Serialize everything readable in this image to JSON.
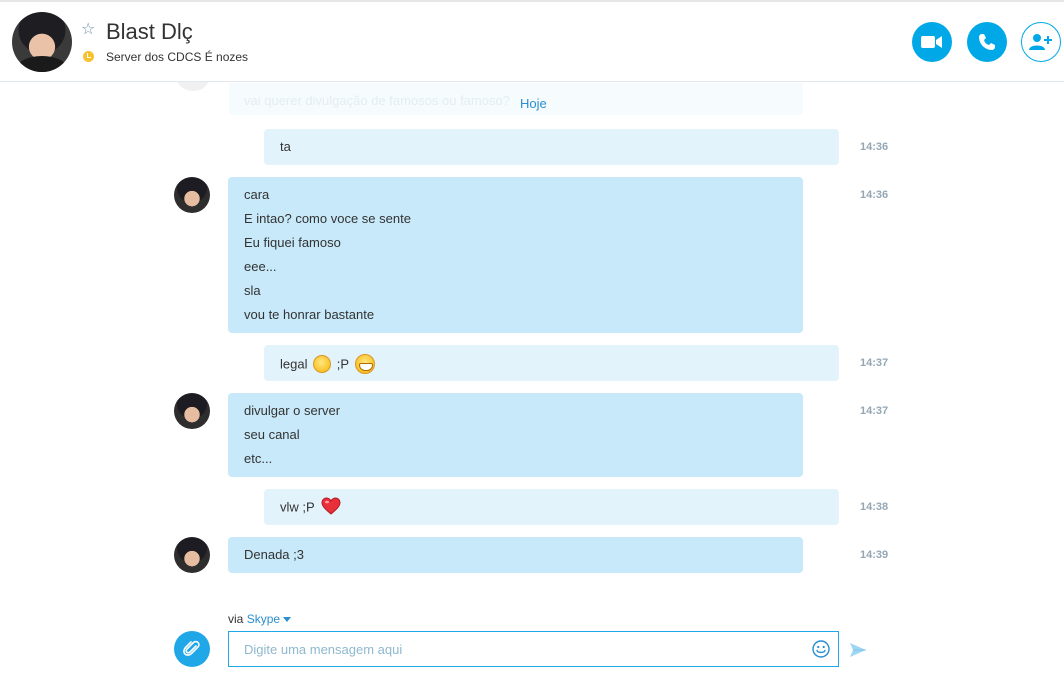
{
  "contact": {
    "name": "Blast Dlç",
    "mood": "Server dos CDCS É nozes",
    "status_color": "#f8c12e"
  },
  "header_buttons": [
    {
      "id": "video-call",
      "icon": "video-camera-icon"
    },
    {
      "id": "audio-call",
      "icon": "phone-icon"
    },
    {
      "id": "add-participant",
      "icon": "add-person-icon"
    }
  ],
  "conversation": {
    "faded_previous": "vai querer divulgação de famosos ou famoso?",
    "day_separator": "Hoje",
    "messages": [
      {
        "direction": "out",
        "lines": [
          "ta"
        ],
        "time": "14:36"
      },
      {
        "direction": "in",
        "lines": [
          "cara",
          "E intao? como voce se sente",
          "Eu fiquei famoso",
          "eee...",
          "sla",
          "vou te honrar bastante"
        ],
        "time": "14:36"
      },
      {
        "direction": "out",
        "text_before": "legal",
        "text_mid": ";P",
        "emoticons": [
          "smile-emoticon",
          "grin-emoticon"
        ],
        "time": "14:37"
      },
      {
        "direction": "in",
        "lines": [
          "divulgar o server",
          "seu canal",
          "etc..."
        ],
        "time": "14:37"
      },
      {
        "direction": "out",
        "text_before": "vlw ;P",
        "emoticons": [
          "heart-emoticon"
        ],
        "time": "14:38"
      },
      {
        "direction": "in",
        "lines": [
          "Denada ;3"
        ],
        "time": "14:39"
      }
    ]
  },
  "composer": {
    "via_label": "via",
    "via_service": "Skype",
    "placeholder": "Digite uma mensagem aqui",
    "value": ""
  },
  "colors": {
    "accent": "#00a8e8",
    "incoming_bubble": "#c7e9f9",
    "outgoing_bubble": "#e3f3fb",
    "link": "#2a8ed0"
  }
}
